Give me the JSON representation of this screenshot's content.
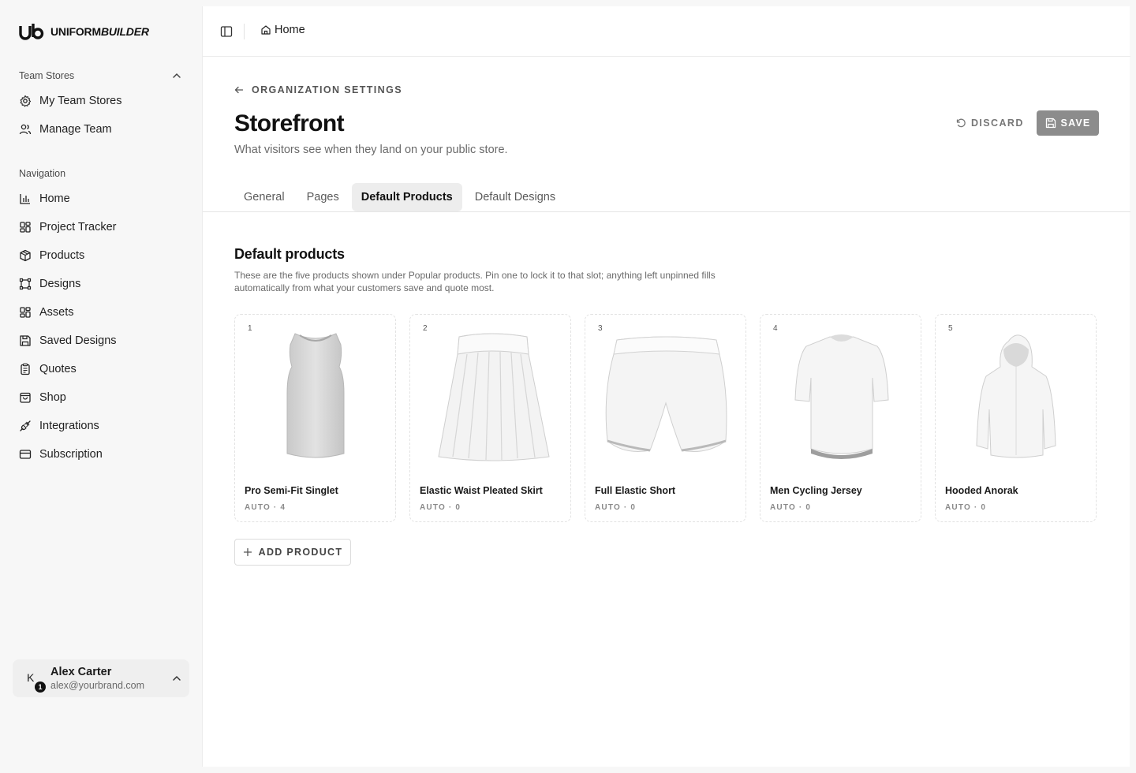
{
  "brand": {
    "name_main": "UNIFORM",
    "name_accent": "BUILDER"
  },
  "sidebar": {
    "team_stores": {
      "label": "Team Stores",
      "items": [
        {
          "label": "My Team Stores",
          "icon": "gear-icon"
        },
        {
          "label": "Manage Team",
          "icon": "users-icon"
        }
      ]
    },
    "navigation": {
      "label": "Navigation",
      "items": [
        {
          "label": "Home",
          "icon": "bar-chart-icon"
        },
        {
          "label": "Project Tracker",
          "icon": "grid-icon"
        },
        {
          "label": "Products",
          "icon": "box-icon"
        },
        {
          "label": "Designs",
          "icon": "frame-icon"
        },
        {
          "label": "Assets",
          "icon": "grid-icon"
        },
        {
          "label": "Saved Designs",
          "icon": "save-icon"
        },
        {
          "label": "Quotes",
          "icon": "clipboard-icon"
        },
        {
          "label": "Shop",
          "icon": "shopping-bag-icon"
        },
        {
          "label": "Integrations",
          "icon": "plug-icon"
        },
        {
          "label": "Subscription",
          "icon": "credit-card-icon"
        }
      ]
    },
    "user": {
      "initial": "K",
      "badge": "1",
      "name": "Alex Carter",
      "email": "alex@yourbrand.com"
    }
  },
  "topbar": {
    "breadcrumb": "Home"
  },
  "page": {
    "back_label": "ORGANIZATION SETTINGS",
    "title": "Storefront",
    "subtitle": "What visitors see when they land on your public store.",
    "discard_label": "DISCARD",
    "save_label": "SAVE"
  },
  "tabs": [
    {
      "label": "General",
      "active": false
    },
    {
      "label": "Pages",
      "active": false
    },
    {
      "label": "Default Products",
      "active": true
    },
    {
      "label": "Default Designs",
      "active": false
    }
  ],
  "section": {
    "title": "Default products",
    "description": "These are the five products shown under Popular products. Pin one to lock it to that slot; anything left unpinned fills automatically from what your customers save and quote most."
  },
  "products": [
    {
      "slot": "1",
      "name": "Pro Semi-Fit Singlet",
      "meta": "AUTO · 4",
      "image": "singlet"
    },
    {
      "slot": "2",
      "name": "Elastic Waist Pleated Skirt",
      "meta": "AUTO · 0",
      "image": "skirt"
    },
    {
      "slot": "3",
      "name": "Full Elastic Short",
      "meta": "AUTO · 0",
      "image": "shorts"
    },
    {
      "slot": "4",
      "name": "Men Cycling Jersey",
      "meta": "AUTO · 0",
      "image": "jersey"
    },
    {
      "slot": "5",
      "name": "Hooded Anorak",
      "meta": "AUTO · 0",
      "image": "anorak"
    }
  ],
  "add_product_label": "ADD PRODUCT",
  "colors": {
    "accent": "#111111",
    "save_button": "#8c8c8c"
  }
}
